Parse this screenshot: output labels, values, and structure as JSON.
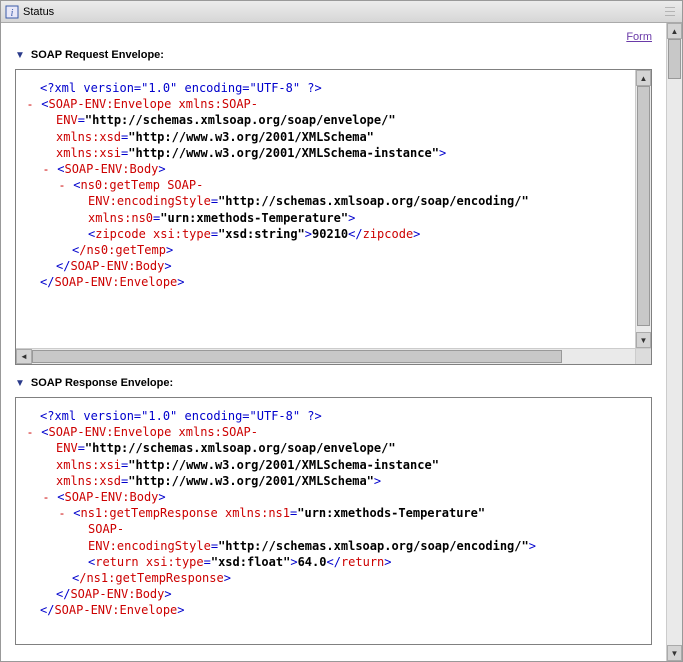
{
  "window": {
    "title": "Status"
  },
  "links": {
    "form": "Form"
  },
  "sections": {
    "request": {
      "title": "SOAP Request Envelope:"
    },
    "response": {
      "title": "SOAP Response Envelope:"
    }
  },
  "xml": {
    "xml_decl": "<?xml version=\"1.0\" encoding=\"UTF-8\" ?>",
    "lt": "<",
    "gt": ">",
    "ltc": "</",
    "sgt": "/>",
    "eq": "=",
    "ns_envelope": "SOAP-ENV:Envelope",
    "ns_body": "SOAP-ENV:Body",
    "attr_xmlns_soapenv_pre": "xmlns:SOAP-",
    "attr_xmlns_soapenv_post": "ENV",
    "attr_xmlns_xsd": "xmlns:xsd",
    "attr_xmlns_xsi": "xmlns:xsi",
    "val_envelope_ns": "\"http://schemas.xmlsoap.org/soap/envelope/\"",
    "val_xsd": "\"http://www.w3.org/2001/XMLSchema\"",
    "val_xsi": "\"http://www.w3.org/2001/XMLSchema-instance\"",
    "req_elem_open": "ns0:getTemp",
    "req_elem_close": "/ns0:getTemp",
    "attr_soap_pre": "SOAP-",
    "attr_encstyle_post": "ENV:encodingStyle",
    "val_encoding": "\"http://schemas.xmlsoap.org/soap/encoding/\"",
    "attr_xmlns_ns0": "xmlns:ns0",
    "val_ns0": "\"urn:xmethods-Temperature\"",
    "zipcode_elem": "zipcode",
    "attr_xsi_type": "xsi:type",
    "val_xsd_string": "\"xsd:string\"",
    "zipcode_text": "90210",
    "resp_elem_open": "ns1:getTempResponse",
    "resp_elem_close": "/ns1:getTempResponse",
    "attr_xmlns_ns1": "xmlns:ns1",
    "val_ns1": "\"urn:xmethods-Temperature\"",
    "return_elem": "return",
    "val_xsd_float": "\"xsd:float\"",
    "return_text": "64.0"
  }
}
